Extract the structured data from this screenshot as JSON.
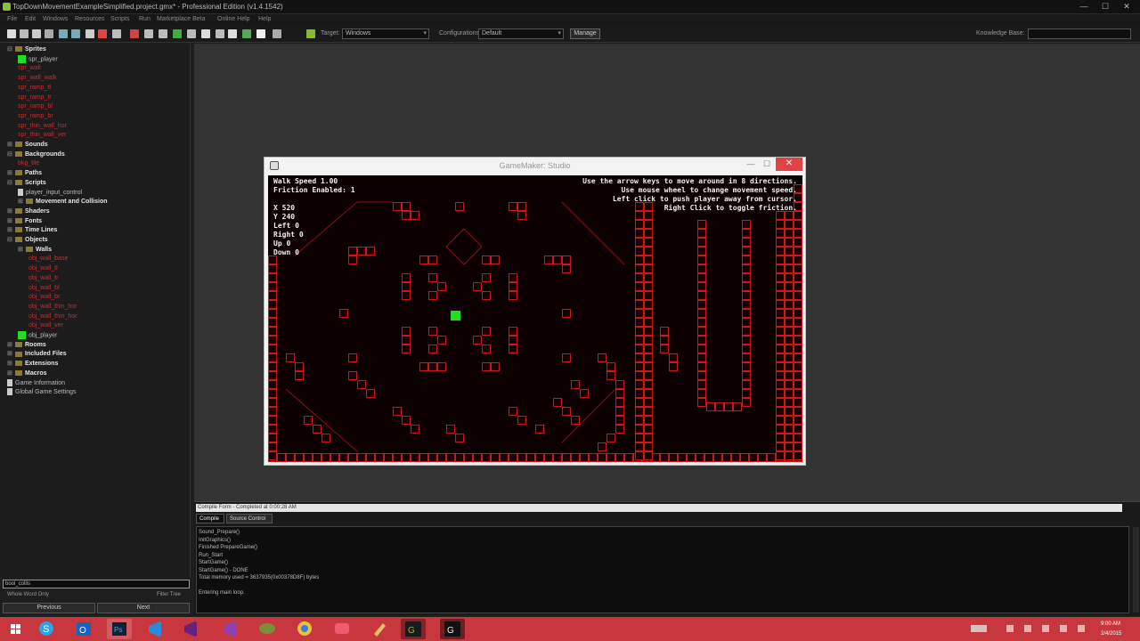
{
  "window": {
    "title": "TopDownMovementExampleSimplified.project.gmx* - Professional Edition (v1.4.1542)",
    "controls": [
      "—",
      "☐",
      "✕"
    ]
  },
  "menubar": {
    "items": [
      "File",
      "Edit",
      "Windows",
      "Resources",
      "Scripts",
      "Run",
      "Marketplace Beta",
      "Online Help",
      "Help"
    ]
  },
  "toolbar": {
    "target_label": "Target:",
    "target_value": "Windows",
    "config_label": "Configurations:",
    "config_value": "Default",
    "manage_label": "Manage",
    "knowledge_label": "Knowledge Base:",
    "knowledge_value": ""
  },
  "tree": {
    "nodes": [
      {
        "label": "Sprites",
        "kind": "folder",
        "indent": 0,
        "expanded": true
      },
      {
        "label": "spr_player",
        "kind": "green",
        "indent": 1
      },
      {
        "label": "spr_wall",
        "kind": "item",
        "indent": 1
      },
      {
        "label": "spr_wall_walk",
        "kind": "item",
        "indent": 1
      },
      {
        "label": "spr_ramp_tl",
        "kind": "item",
        "indent": 1
      },
      {
        "label": "spr_ramp_tr",
        "kind": "item",
        "indent": 1
      },
      {
        "label": "spr_ramp_bl",
        "kind": "item",
        "indent": 1
      },
      {
        "label": "spr_ramp_br",
        "kind": "item",
        "indent": 1
      },
      {
        "label": "spr_thin_wall_hor",
        "kind": "item",
        "indent": 1
      },
      {
        "label": "spr_thin_wall_ver",
        "kind": "item",
        "indent": 1
      },
      {
        "label": "Sounds",
        "kind": "folder",
        "indent": 0
      },
      {
        "label": "Backgrounds",
        "kind": "folder",
        "indent": 0,
        "expanded": true
      },
      {
        "label": "bkg_tile",
        "kind": "item",
        "indent": 1
      },
      {
        "label": "Paths",
        "kind": "folder",
        "indent": 0
      },
      {
        "label": "Scripts",
        "kind": "folder",
        "indent": 0,
        "expanded": true
      },
      {
        "label": "player_input_control",
        "kind": "doc",
        "indent": 1
      },
      {
        "label": "Movement and Collision",
        "kind": "subfolder",
        "indent": 1
      },
      {
        "label": "Shaders",
        "kind": "folder",
        "indent": 0
      },
      {
        "label": "Fonts",
        "kind": "folder",
        "indent": 0
      },
      {
        "label": "Time Lines",
        "kind": "folder",
        "indent": 0
      },
      {
        "label": "Objects",
        "kind": "folder",
        "indent": 0,
        "expanded": true
      },
      {
        "label": "Walls",
        "kind": "subfolder",
        "indent": 1
      },
      {
        "label": "obj_wall_base",
        "kind": "item",
        "indent": 2
      },
      {
        "label": "obj_wall_tl",
        "kind": "item",
        "indent": 2
      },
      {
        "label": "obj_wall_tr",
        "kind": "item",
        "indent": 2
      },
      {
        "label": "obj_wall_bl",
        "kind": "item",
        "indent": 2
      },
      {
        "label": "obj_wall_br",
        "kind": "item",
        "indent": 2
      },
      {
        "label": "obj_wall_thin_hor",
        "kind": "item",
        "indent": 2
      },
      {
        "label": "obj_wall_thin_hor",
        "kind": "item",
        "indent": 2
      },
      {
        "label": "obj_wall_ver",
        "kind": "item",
        "indent": 2
      },
      {
        "label": "obj_player",
        "kind": "green",
        "indent": 1
      },
      {
        "label": "Rooms",
        "kind": "folder",
        "indent": 0
      },
      {
        "label": "Included Files",
        "kind": "folder",
        "indent": 0
      },
      {
        "label": "Extensions",
        "kind": "folder",
        "indent": 0
      },
      {
        "label": "Macros",
        "kind": "folder",
        "indent": 0
      },
      {
        "label": "Game Information",
        "kind": "doc",
        "indent": 0
      },
      {
        "label": "Global Game Settings",
        "kind": "doc",
        "indent": 0
      }
    ],
    "search_value": "bool_collis",
    "sub_options": {
      "left": "Whole Word Only",
      "right": "Filter Tree"
    },
    "buttons": {
      "previous": "Previous",
      "next": "Next"
    }
  },
  "game": {
    "window_title": "GameMaker: Studio",
    "hud_left": [
      "Walk Speed 1.00",
      "Friction Enabled: 1",
      "",
      "X 520",
      "Y 240",
      "Left 0",
      "Right 0",
      "Up 0",
      "Down 0"
    ],
    "hud_right": [
      "Use the arrow keys to move around in 8 directions.",
      "Use mouse wheel to change movement speed.",
      "Left click to push player away from cursor.",
      "Right Click to toggle friction."
    ],
    "colors": {
      "bg": "#0c0000",
      "wall": "#c81818",
      "player": "#22dd22"
    }
  },
  "console": {
    "header": "Compile Form - Completed at 0:00:28 AM",
    "tabs": [
      "Compile",
      "Source Control"
    ],
    "lines": [
      "Sound_Prepare()",
      "InitGraphics()",
      "Finished PrepareGame()",
      "Run_Start",
      "StartGame()",
      "StartGame() - DONE",
      "Total memory used = 3637935(0x00378D8F) bytes",
      "",
      "Entering main loop."
    ]
  },
  "taskbar": {
    "apps": [
      "windows-start",
      "skype",
      "outlook",
      "photoshop",
      "visual-studio",
      "visual-studio-2",
      "chat",
      "chrome",
      "media",
      "pen",
      "gamemaker",
      "gamemaker-studio"
    ],
    "time": "9:00 AM",
    "date": "2/4/2015"
  }
}
